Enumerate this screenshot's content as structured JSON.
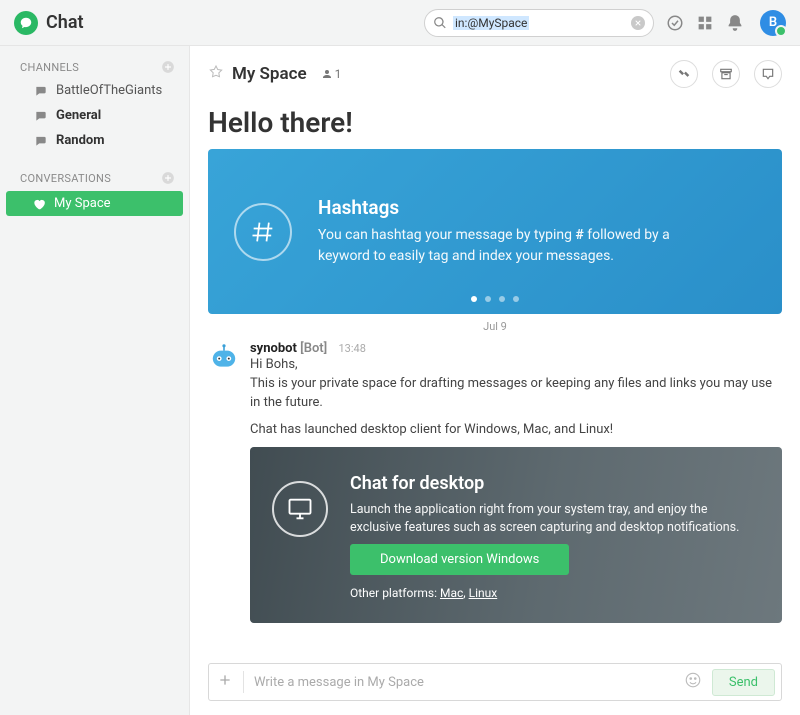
{
  "app": {
    "title": "Chat"
  },
  "search": {
    "value": "in:@MySpace"
  },
  "avatar": {
    "initial": "B"
  },
  "sidebar": {
    "channels_label": "CHANNELS",
    "conversations_label": "CONVERSATIONS",
    "channels": [
      {
        "label": "BattleOfTheGiants",
        "bold": false
      },
      {
        "label": "General",
        "bold": true
      },
      {
        "label": "Random",
        "bold": true
      }
    ],
    "conversations": [
      {
        "label": "My Space",
        "active": true
      }
    ]
  },
  "room": {
    "title": "My Space",
    "member_count": "1",
    "hello": "Hello there!"
  },
  "banner": {
    "title": "Hashtags",
    "body_pre": "You can hashtag your message by typing ",
    "body_bold": "#",
    "body_post": " followed by a keyword to easily tag and index your messages."
  },
  "date_separator": "Jul 9",
  "message": {
    "author": "synobot",
    "tag": "[Bot]",
    "time": "13:48",
    "line1": "Hi Bohs,",
    "line2": "This is your private space for drafting messages or keeping any files and links you may use in the future.",
    "line3": "Chat has launched desktop client for Windows, Mac, and Linux!"
  },
  "desktop_card": {
    "title": "Chat for desktop",
    "body": "Launch the application right from your system tray, and enjoy the exclusive features such as screen capturing and desktop notifications.",
    "button": "Download version Windows",
    "other_prefix": "Other platforms: ",
    "mac": "Mac",
    "sep": ", ",
    "linux": "Linux"
  },
  "composer": {
    "placeholder": "Write a message in My Space",
    "send": "Send"
  }
}
